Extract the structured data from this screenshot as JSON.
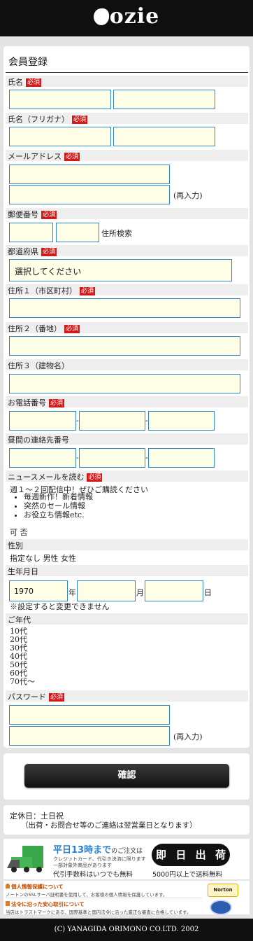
{
  "header": {
    "logo": "ozie"
  },
  "form": {
    "title": "会員登録",
    "required": "必須",
    "name": {
      "label": "氏名"
    },
    "kana": {
      "label": "氏名（フリガナ）"
    },
    "email": {
      "label": "メールアドレス",
      "reenter": "(再入力)"
    },
    "postal": {
      "label": "郵便番号",
      "search": "住所検索"
    },
    "prefecture": {
      "label": "都道府県",
      "selected": "選択してください"
    },
    "address1": {
      "label": "住所１（市区町村）"
    },
    "address2": {
      "label": "住所２（番地）"
    },
    "address3": {
      "label": "住所３（建物名）"
    },
    "phone": {
      "label": "お電話番号",
      "sep": "-"
    },
    "dayphone": {
      "label": "昼間の連絡先番号",
      "sep": "-"
    },
    "newsletter": {
      "label": "ニュースメールを読む",
      "intro": "週１～２回配信中！ぜひご購読ください",
      "bullets": [
        "毎週新作！新着情報",
        "突然のセール情報",
        "お役立ち情報etc."
      ],
      "options": "可 否"
    },
    "gender": {
      "label": "性別",
      "options": "指定なし 男性 女性"
    },
    "birth": {
      "label": "生年月日",
      "year": "1970",
      "year_unit": "年",
      "month_unit": "月",
      "day_unit": "日",
      "note": "※設定すると変更できません"
    },
    "age": {
      "label": "ご年代",
      "options": [
        "10代",
        "20代",
        "30代",
        "40代",
        "50代",
        "60代",
        "70代～"
      ]
    },
    "password": {
      "label": "パスワード",
      "reenter": "(再入力)"
    },
    "confirm_button": "確認"
  },
  "notice": {
    "holiday": "定休日：土日祝",
    "detail": "（出荷・お問合せ等のご連絡は翌営業日となります）"
  },
  "banner": {
    "headline": "平日13時まで",
    "headline_suffix": "のご注文は",
    "sub1": "クレジットカード、代引き決済に限ります",
    "sub2": "一部対象外商品があります",
    "cod": "代引手数料はいつでも無料",
    "same_day": [
      "即",
      "日",
      "出",
      "荷"
    ],
    "free_ship": "5000円以上で送料無料"
  },
  "trust": {
    "privacy_title": "個人情報保護について",
    "privacy_text": "ノートンのSSLサーバ証明書を使用して、お客様の個人情報を保護しています。",
    "norton": "Norton",
    "law_title": "法令に沿った安心取引について",
    "law_text": "当店はトラストマークにある、国際基準と国内法令に沿った厳正な審査に合格しています。"
  },
  "footer": {
    "copyright": "(C) YANAGIDA ORIMONO CO.LTD. 2002"
  },
  "colors": {
    "required": "#d21a1a",
    "input_bg": "#fefee6",
    "input_border": "#2f86c8",
    "header": "#0f0f0f"
  }
}
